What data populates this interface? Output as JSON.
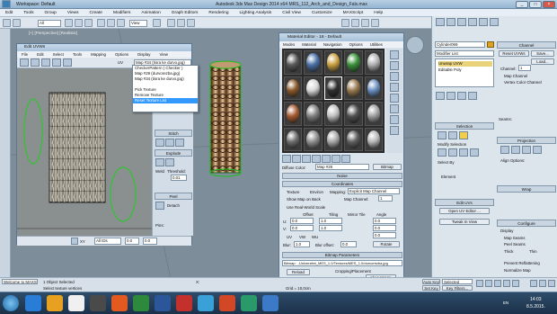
{
  "app": {
    "title": "Autodesk 3ds Max Design 2014 x64     MRS_112_Arch_and_Design_Fals.max",
    "workspace": "Workspace: Default",
    "window_controls": [
      "_",
      "□",
      "×"
    ]
  },
  "menubar": [
    "Edit",
    "Tools",
    "Group",
    "Views",
    "Create",
    "Modifiers",
    "Animation",
    "Graph Editors",
    "Rendering",
    "Lighting Analysis",
    "Civil View",
    "Customize",
    "MAXScript",
    "Help"
  ],
  "toolbar": {
    "selection_filter": "All",
    "view": "View"
  },
  "viewport": {
    "label": "[+] [Perspective] [Realistic]"
  },
  "uvw_editor": {
    "title": "Edit UVWs",
    "menu": [
      "File",
      "Edit",
      "Select",
      "Tools",
      "Mapping",
      "Options",
      "Display",
      "View"
    ],
    "map_select": "Map #34 (tisra ke durvo.jpg)",
    "map_label": "UV",
    "dropdown": [
      "CheckerPattern ( Checker )",
      "Map #29 (durvorezba.jpg)",
      "Map #34 (tisra ke durvo.jpg)",
      "",
      "Pick Texture",
      "Remove Texture",
      "Reset Texture List"
    ],
    "sections": {
      "stitch": "Stitch",
      "explode": "Explode",
      "weld": "Weld",
      "threshold_label": "Threshold:",
      "threshold": "0.01",
      "peel": "Peel",
      "detach": "Detach",
      "pins": "Pins:"
    },
    "bottom": {
      "uv": "XY",
      "all_ids": "All IDs",
      "coord_u": "0.0",
      "coord_v": "0.0"
    }
  },
  "material_editor": {
    "title": "Material Editor - 18 - Default",
    "menu": [
      "Modes",
      "Material",
      "Navigation",
      "Options",
      "Utilities"
    ],
    "slot_colors": [
      "#5a5a5a",
      "#4a6fa5",
      "#c8a040",
      "#3a8f3a",
      "#b0b0b0",
      "#8b5a2b",
      "#d7d7d7",
      "#303030",
      "#9a7a50",
      "#6a8fc0",
      "#a45a30",
      "#7f7f7f",
      "#c0c0c0",
      "#505050",
      "#9f9f9f",
      "#6f6f6f",
      "#8f8f8f",
      "#a8a8a8",
      "#5f5f5f",
      "#b8b8b8"
    ],
    "diffuse_color": "Diffuse Color:",
    "map_name": "Map #29",
    "type": "Bitmap",
    "noise": "Noise",
    "coordinates": {
      "title": "Coordinates",
      "texture": "Texture",
      "environ": "Environ",
      "mapping_label": "Mapping:",
      "mapping": "Explicit Map Channel",
      "show_map_on_back": "Show Map on Back",
      "map_channel_label": "Map Channel:",
      "map_channel": "1",
      "real_world": "Use Real-World Scale",
      "offset": "Offset",
      "tiling": "Tiling",
      "mirror_tile": "Mirror Tile",
      "angle": "Angle",
      "u_offset": "0.0",
      "v_offset": "0.0",
      "u_tiling": "1.0",
      "v_tiling": "1.0",
      "u_angle": "0.0",
      "v_angle": "0.0",
      "w_angle": "0.0",
      "uv": "UV",
      "vw": "VW",
      "wu": "WU",
      "blur_label": "Blur:",
      "blur": "1.0",
      "blur_offset_label": "Blur offset:",
      "blur_offset": "0.0",
      "rotate": "Rotate"
    },
    "bitmap_params": {
      "title": "Bitmap Parameters",
      "bitmap_path": "Bitmap: ..Univerzitet_MES_1.0/Textures/MES_1.0/durvorezba.jpg",
      "reload": "Reload",
      "cropping": "Cropping/Placement",
      "apply": "Apply",
      "view_image": "View Image",
      "crop": "Crop",
      "place": "Place",
      "u_label": "U:",
      "u": "0.0",
      "w_label": "W:",
      "w": "1.0",
      "v_label": "V:",
      "v": "0.0",
      "h_label": "H:",
      "h": "1.0",
      "jitter": "Jitter Placement:",
      "jitter_value": "1.0",
      "filtering": "Filtering",
      "pyramidal": "Pyramidal",
      "summed_area": "Summed Area",
      "none": "None",
      "mono_output": "Mono Channel Output:",
      "rgb_intensity": "RGB Intensity",
      "alpha": "Alpha",
      "alpha_source": "Alpha Source"
    }
  },
  "command_panel": {
    "object_name": "Cylinder069",
    "modifier_list": "Modifier List",
    "stack": [
      "Unwrap UVW",
      "Editable Poly"
    ],
    "channel": "Channel",
    "reset_uvws": "Reset UVWs",
    "save": "Save...",
    "load": "Load...",
    "channel_label": "Channel:",
    "channel_value": "1",
    "map_channel": "Map Channel",
    "vertex_color_channel": "Vertex Color Channel",
    "selection": "Selection",
    "modify_selection": "Modify Selection",
    "select_by": "Select By",
    "element": "Element",
    "edit_uvs": "Edit UVs",
    "open_uv_editor": "Open UV Editor ...",
    "tweak_in_view": "Tweak In View",
    "projection": "Projection",
    "align_options": "Align Options:",
    "wrap": "Wrap",
    "configure": "Configure",
    "display": "Display",
    "map_seams": "Map Seams",
    "peel_seams": "Peel Seams",
    "thick": "Thick",
    "thin": "Thin",
    "prevent_reflattening": "Prevent Reflattening",
    "normalize_map": "Normalize Map",
    "seams": "Seams:"
  },
  "status": {
    "selected": "1 Object Selected",
    "prompt": "Select texture vertices",
    "welcome": "Welcome to MAXS",
    "x_label": "X:",
    "auto_key": "Auto Key",
    "selected_dropdown": "Selected",
    "set_key": "Set Key",
    "key_filters": "Key Filters...",
    "grid": "Grid = 10,0cm"
  },
  "taskbar": {
    "time": "14:03",
    "date": "8.5.2015.",
    "lang": "EN",
    "icon_colors": [
      "#2a7dd6",
      "#e8a020",
      "#f0f0f0",
      "#4a4a4a",
      "#e25a20",
      "#2d8a3c",
      "#2b579a",
      "#c4302b",
      "#3aa0d8",
      "#d24726",
      "#2a9a6a",
      "#3c7ac8"
    ]
  }
}
